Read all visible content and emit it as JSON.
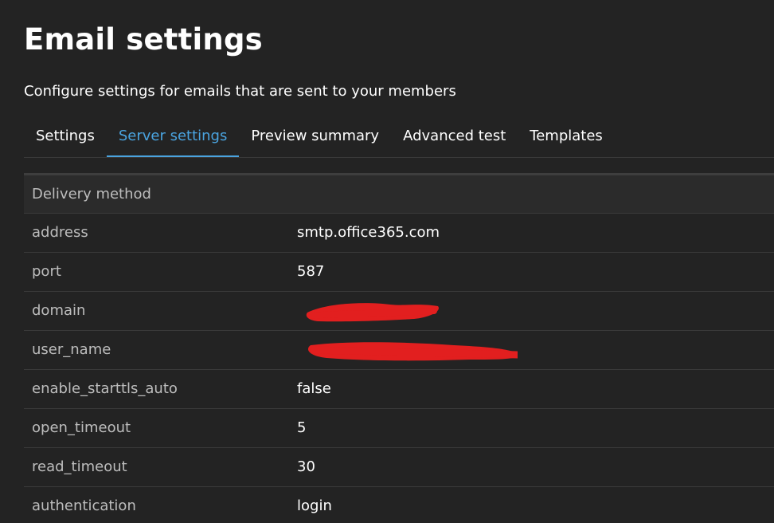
{
  "page": {
    "title": "Email settings",
    "subtitle": "Configure settings for emails that are sent to your members"
  },
  "tabs": [
    {
      "label": "Settings",
      "active": false
    },
    {
      "label": "Server settings",
      "active": true
    },
    {
      "label": "Preview summary",
      "active": false
    },
    {
      "label": "Advanced test",
      "active": false
    },
    {
      "label": "Templates",
      "active": false
    }
  ],
  "server_settings": {
    "section_label": "Delivery method",
    "rows": [
      {
        "key": "address",
        "value": "smtp.office365.com"
      },
      {
        "key": "port",
        "value": "587"
      },
      {
        "key": "domain",
        "value": "",
        "redacted": true
      },
      {
        "key": "user_name",
        "value": "",
        "redacted": true
      },
      {
        "key": "enable_starttls_auto",
        "value": "false"
      },
      {
        "key": "open_timeout",
        "value": "5"
      },
      {
        "key": "read_timeout",
        "value": "30"
      },
      {
        "key": "authentication",
        "value": "login"
      }
    ]
  },
  "colors": {
    "background": "#232323",
    "accent": "#4aa3df",
    "redaction": "#e21f1f"
  }
}
